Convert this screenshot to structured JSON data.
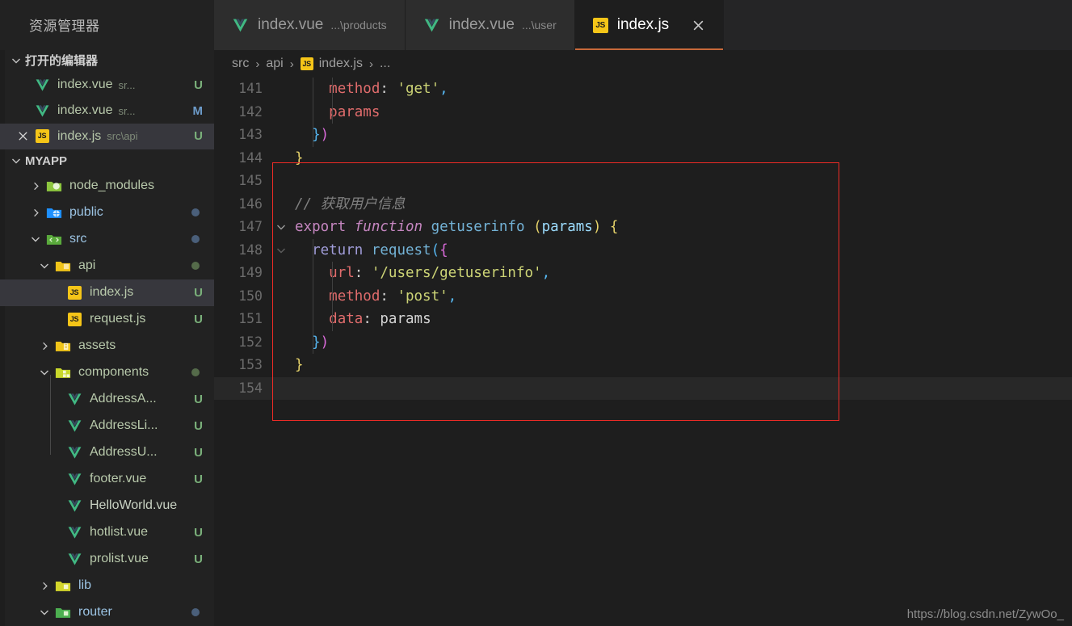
{
  "sidebar": {
    "title": "资源管理器",
    "open_editors": {
      "label": "打开的编辑器",
      "items": [
        {
          "icon": "vue-icon",
          "name": "index.vue",
          "desc": "sr...",
          "status": "U"
        },
        {
          "icon": "vue-icon",
          "name": "index.vue",
          "desc": "sr...",
          "status": "M"
        },
        {
          "icon": "js-icon",
          "name": "index.js",
          "desc": "src\\api",
          "status": "U",
          "selected": true,
          "close": "×"
        }
      ]
    },
    "project": {
      "label": "MYAPP",
      "items": [
        {
          "name": "node_modules",
          "type": "folder",
          "expanded": false,
          "depth": 1,
          "color": "green",
          "badge": ""
        },
        {
          "name": "public",
          "type": "folder",
          "expanded": false,
          "depth": 1,
          "color": "blue",
          "badge": "blue"
        },
        {
          "name": "src",
          "type": "folder",
          "expanded": true,
          "depth": 1,
          "color": "green",
          "badge": "blue"
        },
        {
          "name": "api",
          "type": "folder",
          "expanded": true,
          "depth": 2,
          "color": "yellow",
          "badge": "green"
        },
        {
          "name": "index.js",
          "type": "js",
          "depth": 3,
          "status": "U",
          "selected": true
        },
        {
          "name": "request.js",
          "type": "js",
          "depth": 3,
          "status": "U"
        },
        {
          "name": "assets",
          "type": "folder",
          "expanded": false,
          "depth": 2,
          "color": "yellow",
          "badge": ""
        },
        {
          "name": "components",
          "type": "folder",
          "expanded": true,
          "depth": 2,
          "color": "yellow",
          "badge": "green"
        },
        {
          "name": "AddressA...",
          "type": "vue",
          "depth": 3,
          "status": "U"
        },
        {
          "name": "AddressLi...",
          "type": "vue",
          "depth": 3,
          "status": "U"
        },
        {
          "name": "AddressU...",
          "type": "vue",
          "depth": 3,
          "status": "U"
        },
        {
          "name": "footer.vue",
          "type": "vue",
          "depth": 3,
          "status": "U"
        },
        {
          "name": "HelloWorld.vue",
          "type": "vue",
          "depth": 3,
          "status": ""
        },
        {
          "name": "hotlist.vue",
          "type": "vue",
          "depth": 3,
          "status": "U"
        },
        {
          "name": "prolist.vue",
          "type": "vue",
          "depth": 3,
          "status": "U"
        },
        {
          "name": "lib",
          "type": "folder",
          "expanded": false,
          "depth": 2,
          "color": "yellow",
          "badge": ""
        },
        {
          "name": "router",
          "type": "folder",
          "expanded": true,
          "depth": 2,
          "color": "green",
          "badge": "blue"
        }
      ]
    }
  },
  "tabs": [
    {
      "icon": "vue-icon",
      "label": "index.vue",
      "desc": "...\\products",
      "active": false,
      "closable": false
    },
    {
      "icon": "vue-icon",
      "label": "index.vue",
      "desc": "...\\user",
      "active": false,
      "closable": false
    },
    {
      "icon": "js-icon",
      "label": "index.js",
      "desc": "",
      "active": true,
      "closable": true,
      "close_label": "✕"
    }
  ],
  "breadcrumb": {
    "parts": [
      "src",
      "api",
      "index.js",
      "..."
    ],
    "separator": "›",
    "file_icon": "js-icon"
  },
  "editor": {
    "first_line": 141,
    "current_line": 154,
    "breakpoint_line": 147,
    "lines": [
      {
        "n": 141,
        "indent": 2,
        "text": "method: 'get',"
      },
      {
        "n": 142,
        "indent": 2,
        "text": "params"
      },
      {
        "n": 143,
        "indent": 1,
        "text": "})"
      },
      {
        "n": 144,
        "indent": 0,
        "text": "}"
      },
      {
        "n": 145,
        "indent": 0,
        "text": ""
      },
      {
        "n": 146,
        "indent": 0,
        "text": "// 获取用户信息"
      },
      {
        "n": 147,
        "indent": 0,
        "text": "export function getuserinfo (params) {"
      },
      {
        "n": 148,
        "indent": 1,
        "text": "return request({"
      },
      {
        "n": 149,
        "indent": 2,
        "text": "url: '/users/getuserinfo',"
      },
      {
        "n": 150,
        "indent": 2,
        "text": "method: 'post',"
      },
      {
        "n": 151,
        "indent": 2,
        "text": "data: params"
      },
      {
        "n": 152,
        "indent": 1,
        "text": "})"
      },
      {
        "n": 153,
        "indent": 0,
        "text": "}"
      },
      {
        "n": 154,
        "indent": 0,
        "text": ""
      }
    ]
  },
  "annotation": {
    "type": "red-rectangle-highlight",
    "covers_lines": "145-154"
  },
  "watermark": "https://blog.csdn.net/ZywOo_",
  "colors": {
    "editor_bg": "#1e1e1e",
    "sidebar_bg": "#222222",
    "tab_inactive_bg": "#2d2d2d",
    "selection_bg": "#37373d",
    "accent_tab_underline": "#c8693a",
    "annotation_red": "#ee2b26",
    "js_badge": "#f5c518"
  }
}
